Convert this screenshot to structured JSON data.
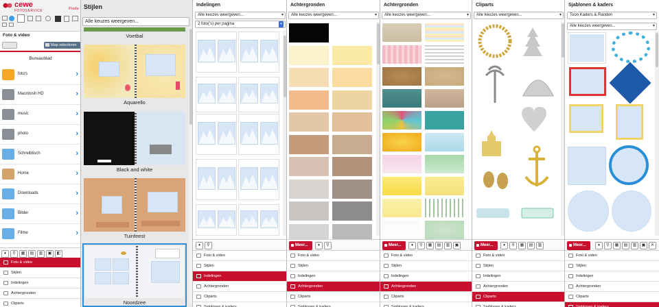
{
  "app": {
    "brand_name": "cewe",
    "brand_sub": "FOTOSERVICE",
    "product_tab": "Produ",
    "section_title": "Foto & video",
    "back_button": "",
    "folder_button": "Map selecteren",
    "location": "Bureaublad"
  },
  "sidebar": {
    "items": [
      {
        "label": "foto's",
        "icon": "photos-app-icon",
        "color": "#f5a623"
      },
      {
        "label": "Macintosh HD",
        "icon": "hard-drive-icon",
        "color": "#8a8f96"
      },
      {
        "label": "music",
        "icon": "drive-icon",
        "color": "#8a8f96"
      },
      {
        "label": "photo",
        "icon": "drive-icon",
        "color": "#8a8f96"
      },
      {
        "label": "Schreibtisch",
        "icon": "folder-icon",
        "color": "#6aaee6"
      },
      {
        "label": "Home",
        "icon": "home-icon",
        "color": "#d2a36b"
      },
      {
        "label": "Downloads",
        "icon": "downloads-folder-icon",
        "color": "#6aaee6"
      },
      {
        "label": "Bilder",
        "icon": "pictures-folder-icon",
        "color": "#6aaee6"
      },
      {
        "label": "Filme",
        "icon": "movies-folder-icon",
        "color": "#6aaee6"
      }
    ]
  },
  "nav": {
    "items": [
      "Foto & video",
      "Stijlen",
      "Indelingen",
      "Achtergronden",
      "Cliparts",
      "Sjablonen & kaders"
    ]
  },
  "styles_panel": {
    "title": "Stijlen",
    "filter": "Alle keuzes weergeven...",
    "cards": [
      "Voetbal",
      "Aquarello",
      "Black and white",
      "Tuinfeest",
      "Noordzee"
    ]
  },
  "layouts_panel": {
    "title": "Indelingen",
    "filter": "Alle keuzes weergeven...",
    "per_page": "2 foto('s) per pagina"
  },
  "bg_panel_1": {
    "title": "Achtergronden",
    "filter": "Alle keuzes weergeven...",
    "meer": "Meer..."
  },
  "bg_panel_2": {
    "title": "Achtergronden",
    "filter": "Alle keuzes weergeven...",
    "meer": "Meer..."
  },
  "cliparts_panel": {
    "title": "Cliparts",
    "filter": "Alle keuzes weergeven...",
    "meer": "Meer..."
  },
  "templates_panel": {
    "title": "Sjablonen & kaders",
    "filter1": "Toon Kaders & Randen",
    "filter2": "Alle keuzes weergeven...",
    "meer": "Meer..."
  },
  "colors": {
    "accent": "#c8102e",
    "link_blue": "#1c7cd5"
  }
}
